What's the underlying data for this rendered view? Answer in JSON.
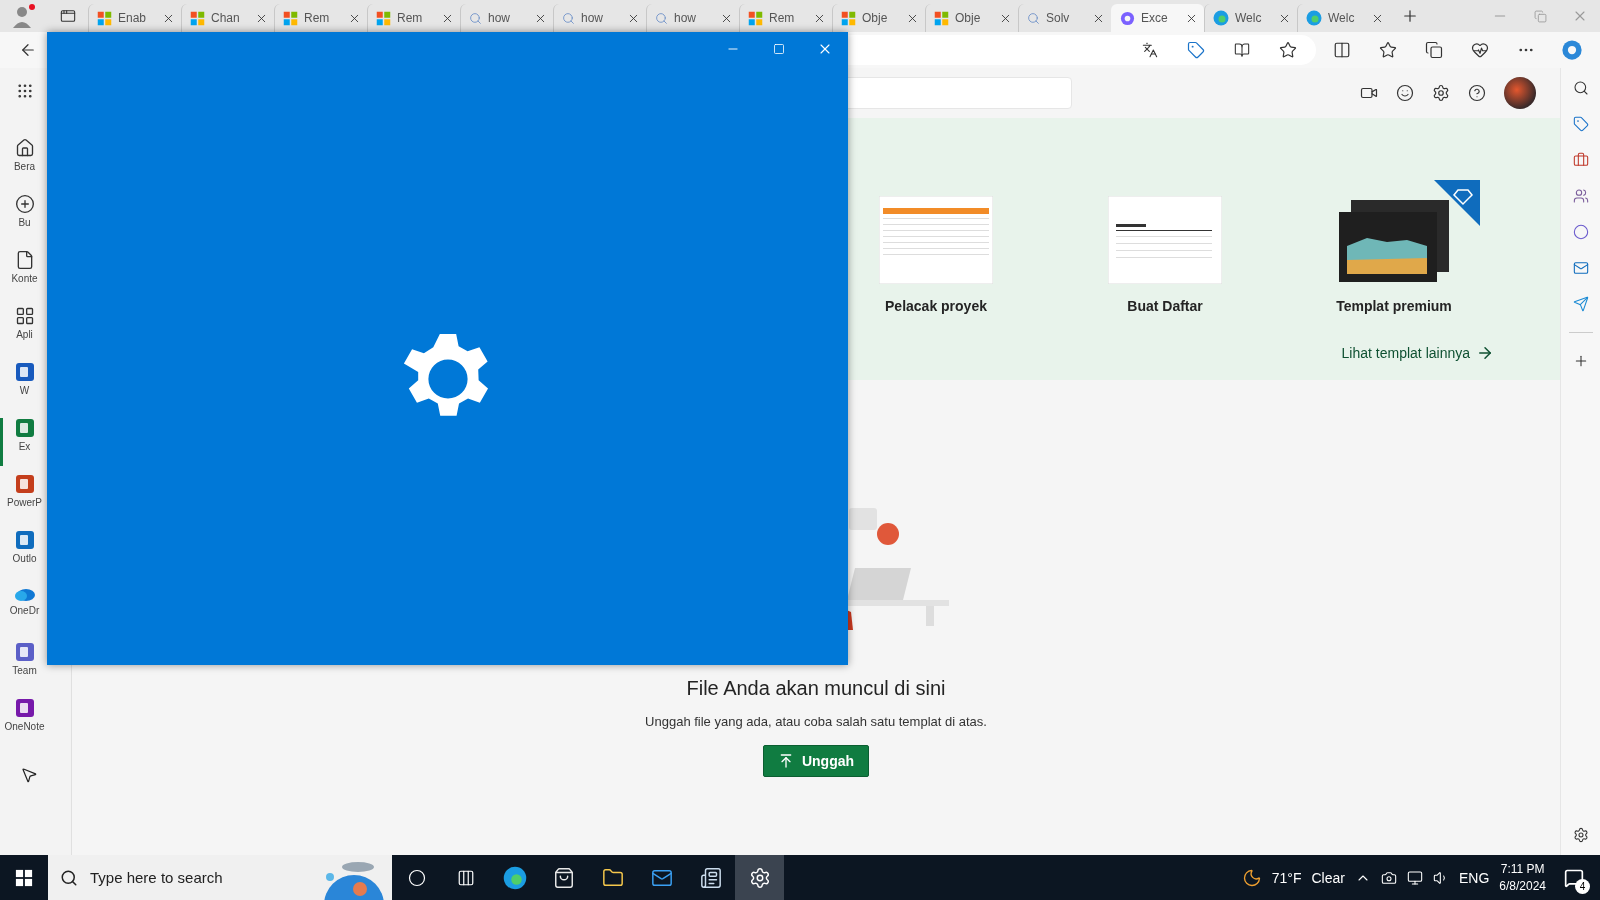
{
  "browser": {
    "tabs": [
      {
        "label": "Enab",
        "kind": "windows",
        "selected": false
      },
      {
        "label": "Chan",
        "kind": "windows",
        "selected": false
      },
      {
        "label": "Rem",
        "kind": "windows",
        "selected": false
      },
      {
        "label": "Rem",
        "kind": "windows",
        "selected": false
      },
      {
        "label": "how",
        "kind": "search",
        "selected": false
      },
      {
        "label": "how",
        "kind": "search",
        "selected": false
      },
      {
        "label": "how",
        "kind": "search",
        "selected": false
      },
      {
        "label": "Rem",
        "kind": "windows",
        "selected": false
      },
      {
        "label": "Obje",
        "kind": "windows",
        "selected": false
      },
      {
        "label": "Obje",
        "kind": "windows",
        "selected": false
      },
      {
        "label": "Solv",
        "kind": "search",
        "selected": false
      },
      {
        "label": "Exce",
        "kind": "copilot",
        "selected": true
      },
      {
        "label": "Welc",
        "kind": "edge",
        "selected": false
      },
      {
        "label": "Welc",
        "kind": "edge",
        "selected": false
      }
    ]
  },
  "app_rail": {
    "items": [
      {
        "label": "Bera",
        "kind": "home",
        "selected": false
      },
      {
        "label": "Bu",
        "kind": "create",
        "selected": false
      },
      {
        "label": "Konte",
        "kind": "content",
        "selected": false
      },
      {
        "label": "Apli",
        "kind": "apps",
        "selected": false
      },
      {
        "label": "W",
        "kind": "word",
        "selected": false
      },
      {
        "label": "Ex",
        "kind": "excel",
        "selected": true
      },
      {
        "label": "PowerP",
        "kind": "powerpoint",
        "selected": false
      },
      {
        "label": "Outlo",
        "kind": "outlook",
        "selected": false
      },
      {
        "label": "OneDr",
        "kind": "onedrive",
        "selected": false
      },
      {
        "label": "Team",
        "kind": "teams",
        "selected": false
      },
      {
        "label": "OneNote",
        "kind": "onenote",
        "selected": false
      }
    ]
  },
  "templates": {
    "items": [
      {
        "title": "Pelacak proyek",
        "kind": "tracker",
        "premium": false
      },
      {
        "title": "Buat Daftar",
        "kind": "list",
        "premium": false
      },
      {
        "title": "Templat premium",
        "kind": "dashboard",
        "premium": true
      }
    ],
    "more_link": "Lihat templat lainnya"
  },
  "empty_state": {
    "title": "File Anda akan muncul di sini",
    "subtitle": "Unggah file yang ada, atau coba salah satu templat di atas.",
    "button": "Unggah"
  },
  "taskbar": {
    "search_placeholder": "Type here to search",
    "apps": [
      {
        "kind": "cortana",
        "selected": false
      },
      {
        "kind": "taskview",
        "selected": false
      },
      {
        "kind": "edge",
        "selected": false
      },
      {
        "kind": "store",
        "selected": false
      },
      {
        "kind": "explorer",
        "selected": false
      },
      {
        "kind": "mail",
        "selected": false
      },
      {
        "kind": "news",
        "selected": false
      },
      {
        "kind": "settings",
        "selected": true
      }
    ],
    "weather": {
      "temperature": "71°F",
      "condition": "Clear"
    },
    "language": "ENG",
    "time": "7:11 PM",
    "date": "6/8/2024",
    "notifications": "4"
  }
}
